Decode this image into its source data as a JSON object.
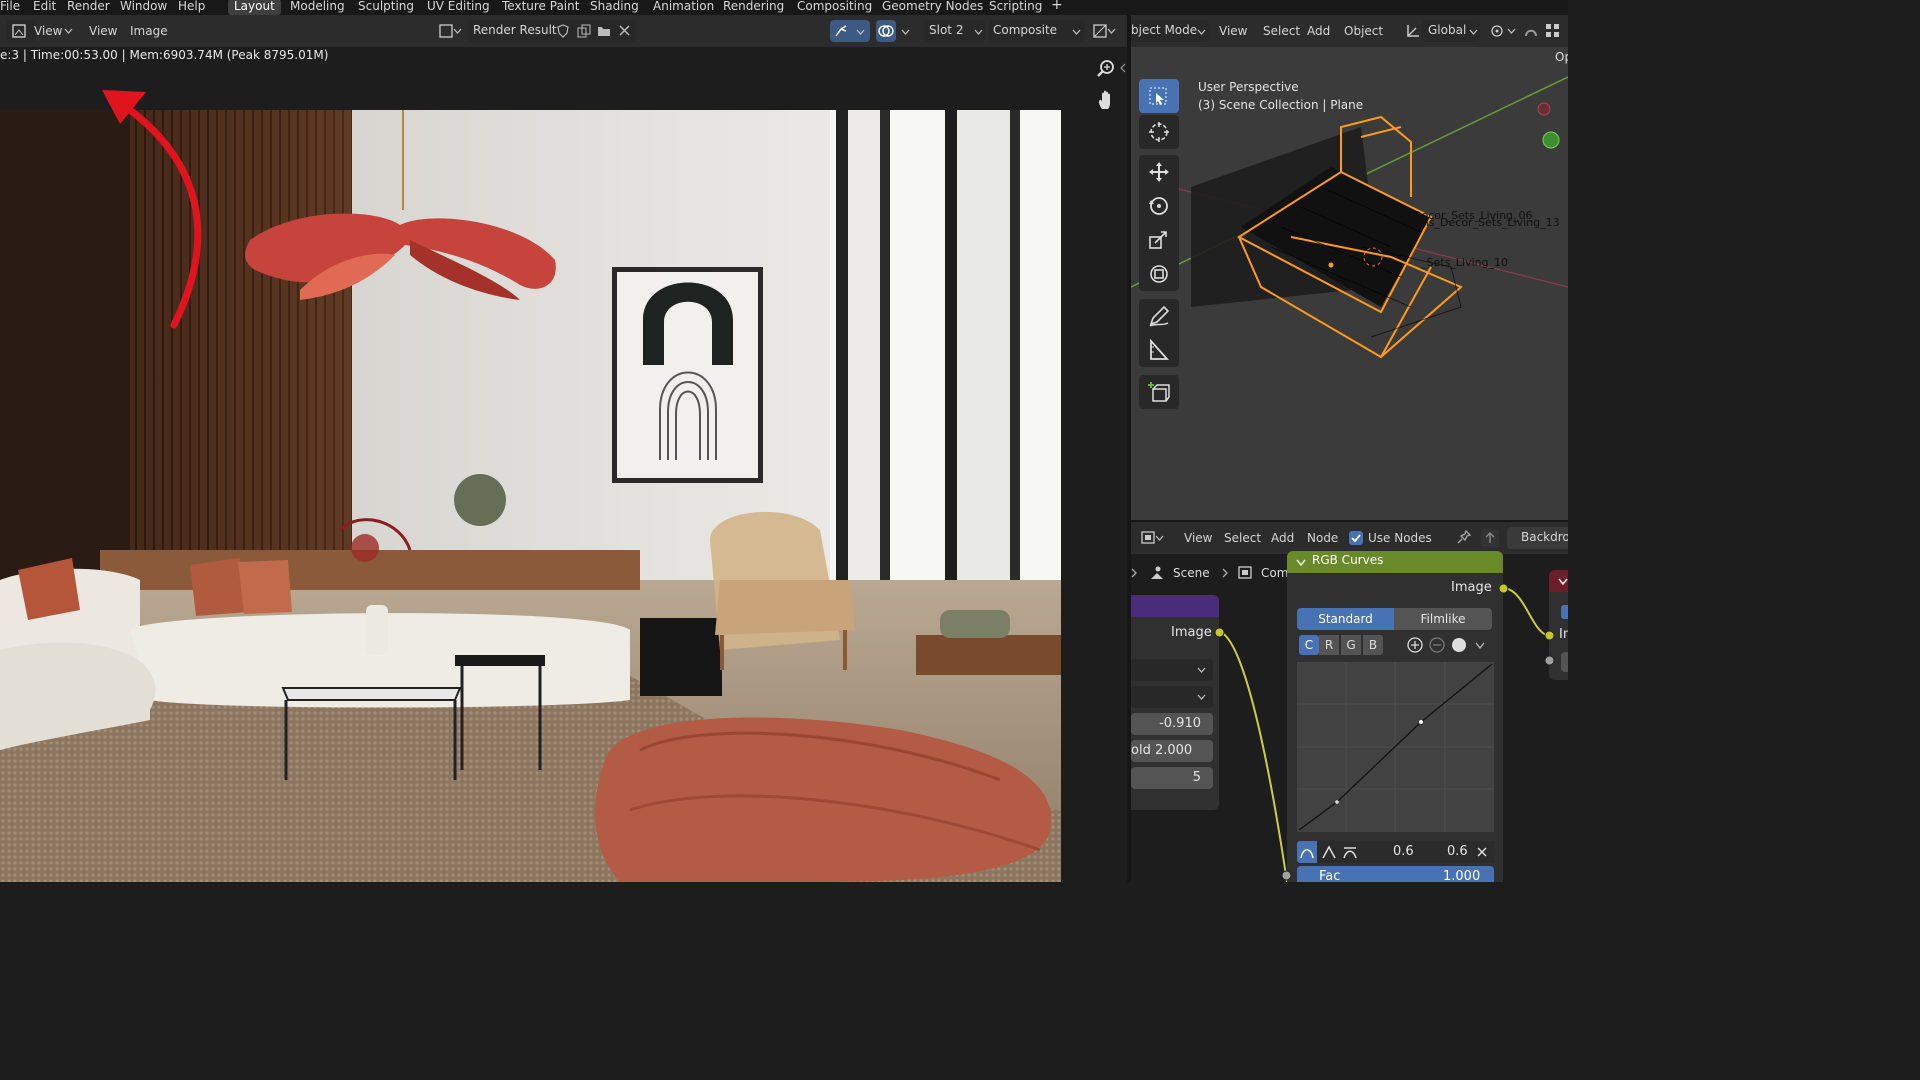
{
  "menu": [
    "File",
    "Edit",
    "Render",
    "Window",
    "Help"
  ],
  "workspaces": [
    "Layout",
    "Modeling",
    "Sculpting",
    "UV Editing",
    "Texture Paint",
    "Shading",
    "Animation",
    "Rendering",
    "Compositing",
    "Geometry Nodes",
    "Scripting"
  ],
  "active_workspace": "Layout",
  "image_editor": {
    "menu_view": "View",
    "menu_view2": "View",
    "menu_image": "Image",
    "image_name": "Render Result",
    "slot": "Slot 2",
    "pass": "Composite",
    "stats": "e:3 | Time:00:53.00 | Mem:6903.74M (Peak 8795.01M)"
  },
  "viewport": {
    "mode": "bject Mode",
    "menus": [
      "View",
      "Select",
      "Add",
      "Object"
    ],
    "transform": "Global",
    "overlay_title": "User Perspective",
    "overlay_collection": "(3) Scene Collection | Plane",
    "object_labels": [
      "Decor_Sets_Living_06",
      "ations_Decor_Sets_Living_13",
      "_Sets_Living_10"
    ],
    "corner_label": "Op"
  },
  "node_editor": {
    "menus": [
      "View",
      "Select",
      "Add",
      "Node"
    ],
    "use_nodes": "Use Nodes",
    "backdrop": "Backdrop",
    "breadcrumb_scene": "Scene",
    "breadcrumb_tree": "Compositing Nodetree",
    "left_node": {
      "socket_label": "Image",
      "values": [
        "-0.910",
        "old  2.000",
        "5"
      ]
    },
    "rgb_curves": {
      "title": "RGB Curves",
      "output": "Image",
      "tab_standard": "Standard",
      "tab_filmlike": "Filmlike",
      "channels": [
        "C",
        "R",
        "G",
        "B"
      ],
      "val_x": "0.6",
      "val_y": "0.6",
      "fac_label": "Fac",
      "fac_value": "1.000"
    },
    "right_node_label": "In"
  },
  "colors": {
    "accent": "#4772b3",
    "node_header": "#6a8a2a",
    "socket": "#c7c729",
    "arrow": "#e0141e",
    "wire": "#c9cf3e",
    "selection": "#ff9a1f"
  }
}
